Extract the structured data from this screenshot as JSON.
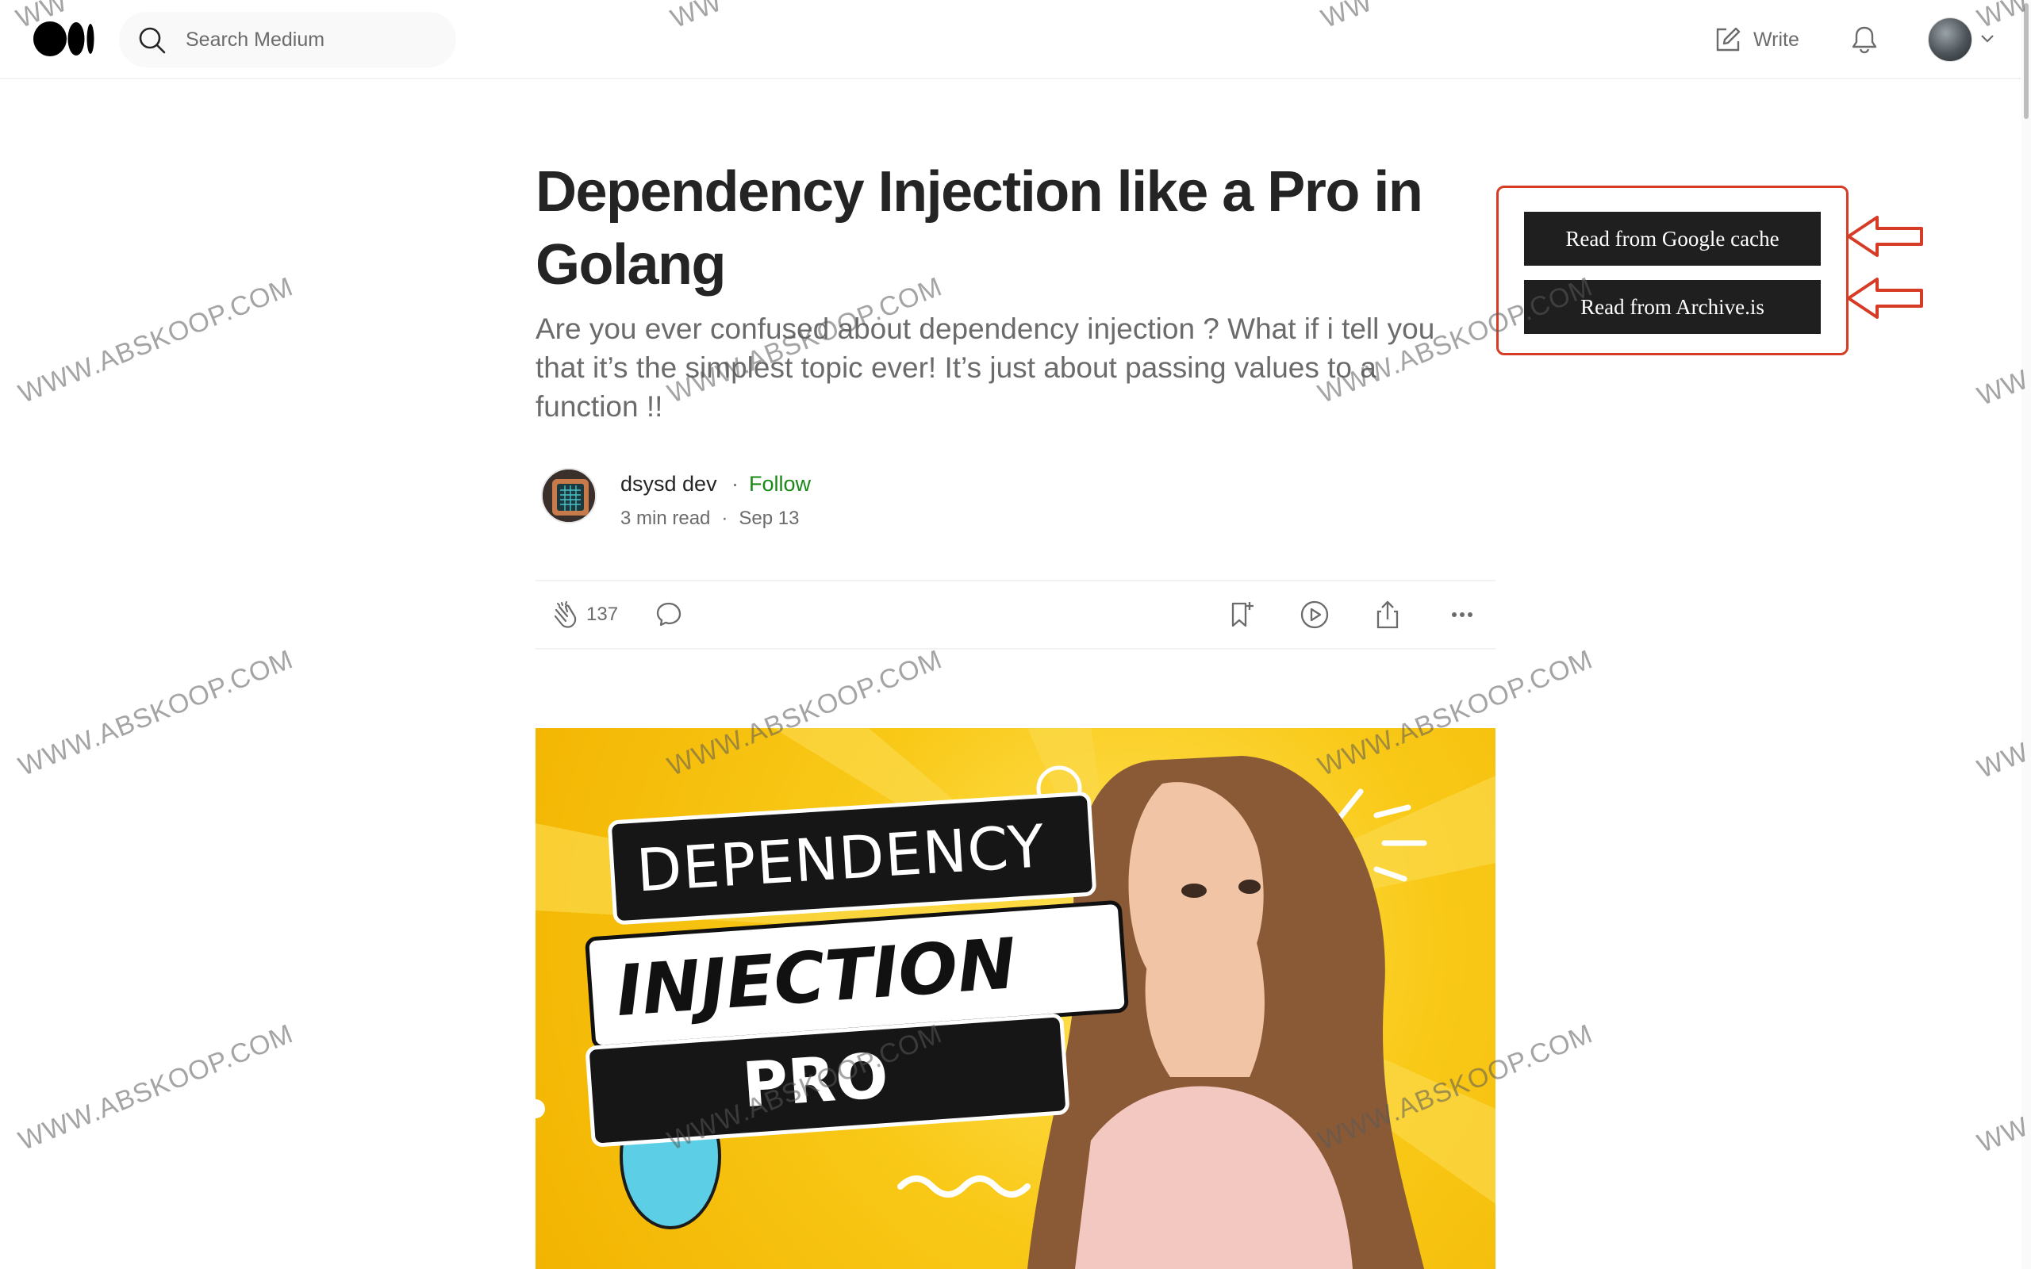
{
  "header": {
    "search_placeholder": "Search Medium",
    "write_label": "Write"
  },
  "article": {
    "title": "Dependency Injection like a Pro in Golang",
    "subtitle": "Are you ever confused about dependency injection ? What if i tell you that it’s the simplest topic ever! It’s just about passing values to a function !!",
    "author": "dsysd dev",
    "separator": "·",
    "follow_label": "Follow",
    "read_time": "3 min read",
    "date": "Sep 13",
    "clap_count": "137"
  },
  "hero": {
    "line1": "DEPENDENCY",
    "line2": "INJECTION",
    "line3": "PRO"
  },
  "helper": {
    "google_cache_label": "Read from Google cache",
    "archive_label": "Read from Archive.is",
    "border_color": "#d63c25"
  },
  "watermark": {
    "text": "WWW.ABSKOOP.COM",
    "partial": "WW"
  },
  "colors": {
    "follow_green": "#1a8917",
    "text_primary": "#242424",
    "text_secondary": "#6b6b6b"
  }
}
